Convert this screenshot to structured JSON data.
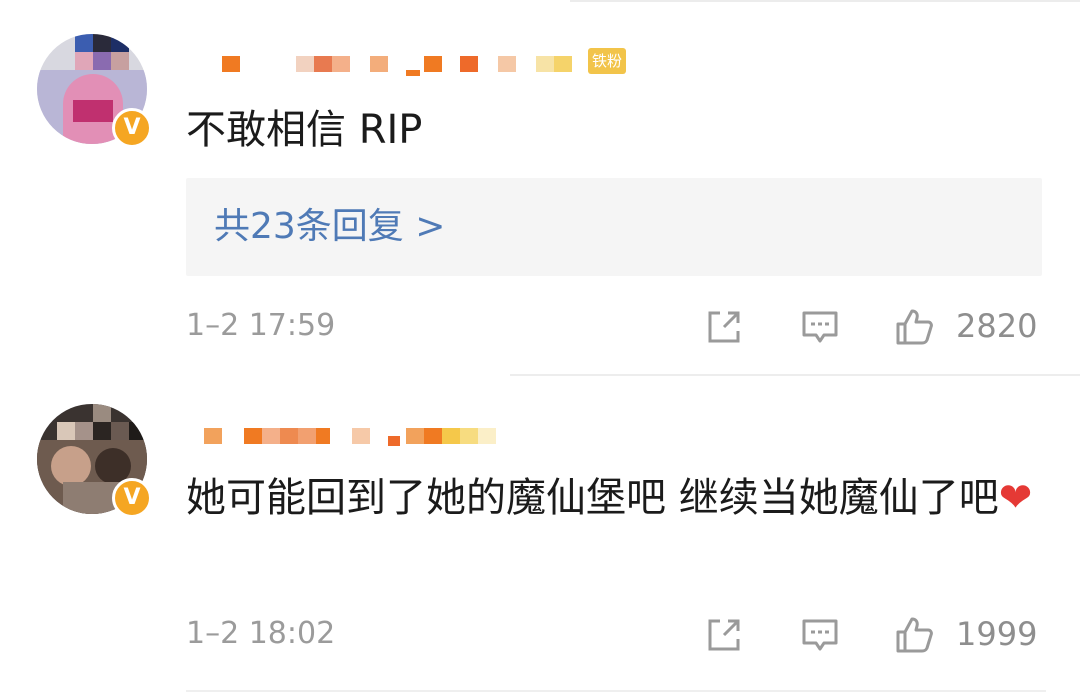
{
  "comments": [
    {
      "badge": "铁粉",
      "text": "不敢相信 RIP",
      "replies_label": "共23条回复 >",
      "time": "1–2 17:59",
      "likes": "2820",
      "verified_mark": "V"
    },
    {
      "text": "她可能回到了她的魔仙堡吧 继续当她魔仙了吧",
      "emoji": "❤",
      "time": "1–2 18:02",
      "likes": "1999",
      "verified_mark": "V"
    }
  ],
  "colors": {
    "link": "#4f7ab6",
    "muted": "#9b9b9b",
    "verified": "#f5a623",
    "heart": "#e53935"
  },
  "icons": [
    "share-icon",
    "reply-icon",
    "like-icon",
    "verified-icon"
  ]
}
